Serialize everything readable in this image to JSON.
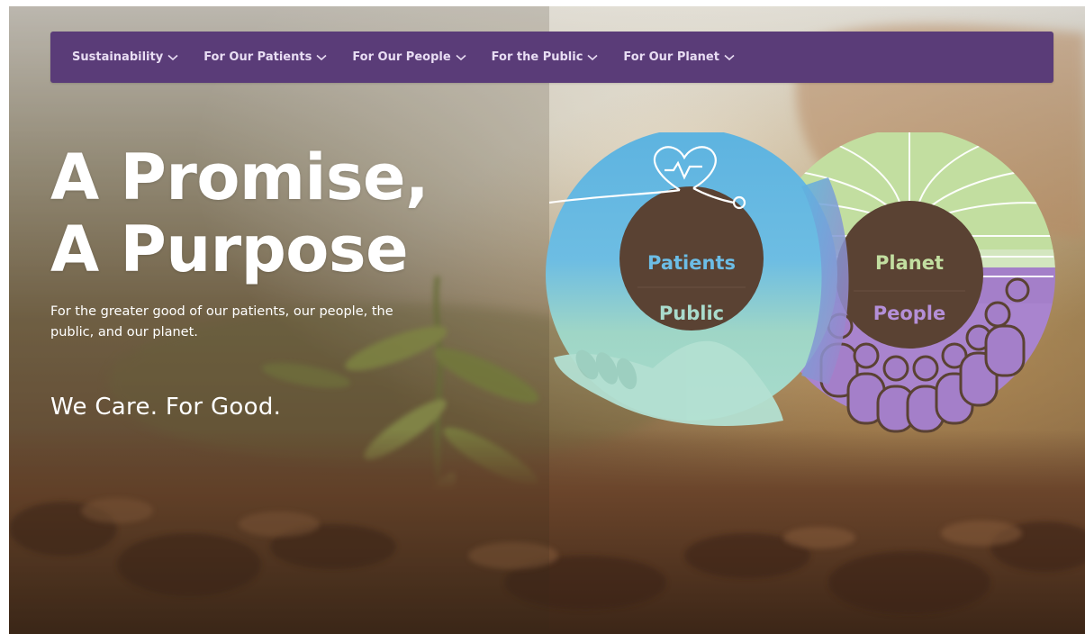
{
  "nav": {
    "items": [
      {
        "label": "Sustainability"
      },
      {
        "label": "For Our Patients"
      },
      {
        "label": "For Our People"
      },
      {
        "label": "For the Public"
      },
      {
        "label": "For Our Planet"
      }
    ]
  },
  "hero": {
    "title_line1": "A Promise,",
    "title_line2": "A Purpose",
    "subtitle": "For the greater good of our patients, our people, the public, and our planet.",
    "tagline": "We Care. For Good."
  },
  "emblem": {
    "left_ring": {
      "top_label": "Patients",
      "bottom_label": "Public"
    },
    "right_ring": {
      "top_label": "Planet",
      "bottom_label": "People"
    }
  },
  "colors": {
    "nav_bg": "#5a3c78",
    "patients_blue": "#5db3e0",
    "public_teal": "#9fd6c6",
    "planet_green": "#c2dea0",
    "people_purple": "#a47fc9",
    "ring_center": "#5a4233"
  },
  "icons": [
    "chevron-down-icon",
    "heart-rate-icon",
    "hand-icon",
    "plant-leaves-icon",
    "people-icon"
  ]
}
